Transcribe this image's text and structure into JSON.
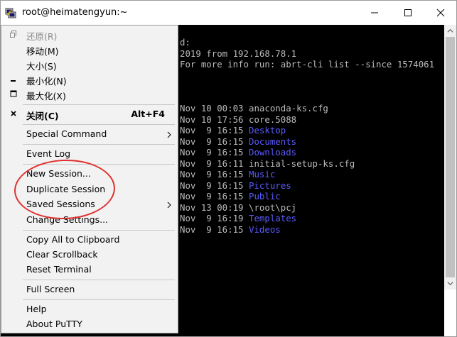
{
  "window": {
    "title": "root@heimatengyun:~"
  },
  "terminal": {
    "header_lines": [
      "d:",
      "2019 from 192.168.78.1",
      "For more info run: abrt-cli list --since 1574061"
    ],
    "listing": [
      {
        "date": "Nov 10 00:03",
        "name": "anaconda-ks.cfg",
        "is_dir": false
      },
      {
        "date": "Nov 10 17:56",
        "name": "core.5088",
        "is_dir": false
      },
      {
        "date": "Nov  9 16:15",
        "name": "Desktop",
        "is_dir": true
      },
      {
        "date": "Nov  9 16:15",
        "name": "Documents",
        "is_dir": true
      },
      {
        "date": "Nov  9 16:15",
        "name": "Downloads",
        "is_dir": true
      },
      {
        "date": "Nov  9 16:11",
        "name": "initial-setup-ks.cfg",
        "is_dir": false
      },
      {
        "date": "Nov  9 16:15",
        "name": "Music",
        "is_dir": true
      },
      {
        "date": "Nov  9 16:15",
        "name": "Pictures",
        "is_dir": true
      },
      {
        "date": "Nov  9 16:15",
        "name": "Public",
        "is_dir": true
      },
      {
        "date": "Nov 13 00:19",
        "name": "\\root\\pcj",
        "is_dir": false
      },
      {
        "date": "Nov  9 16:19",
        "name": "Templates",
        "is_dir": true
      },
      {
        "date": "Nov  9 16:15",
        "name": "Videos",
        "is_dir": true
      }
    ],
    "colors": {
      "background": "#000000",
      "text": "#bbbbbb",
      "directory": "#5b5bff"
    }
  },
  "menu": {
    "restore": "还原(R)",
    "move": "移动(M)",
    "size": "大小(S)",
    "minimize": "最小化(N)",
    "maximize": "最大化(X)",
    "close": "关闭(C)",
    "close_accel": "Alt+F4",
    "special_command": "Special Command",
    "event_log": "Event Log",
    "new_session": "New Session...",
    "duplicate_session": "Duplicate Session",
    "saved_sessions": "Saved Sessions",
    "change_settings": "Change Settings...",
    "copy_all": "Copy All to Clipboard",
    "clear_scrollback": "Clear Scrollback",
    "reset_terminal": "Reset Terminal",
    "full_screen": "Full Screen",
    "help": "Help",
    "about": "About PuTTY"
  },
  "annotation": {
    "circle_color": "#e03030"
  }
}
